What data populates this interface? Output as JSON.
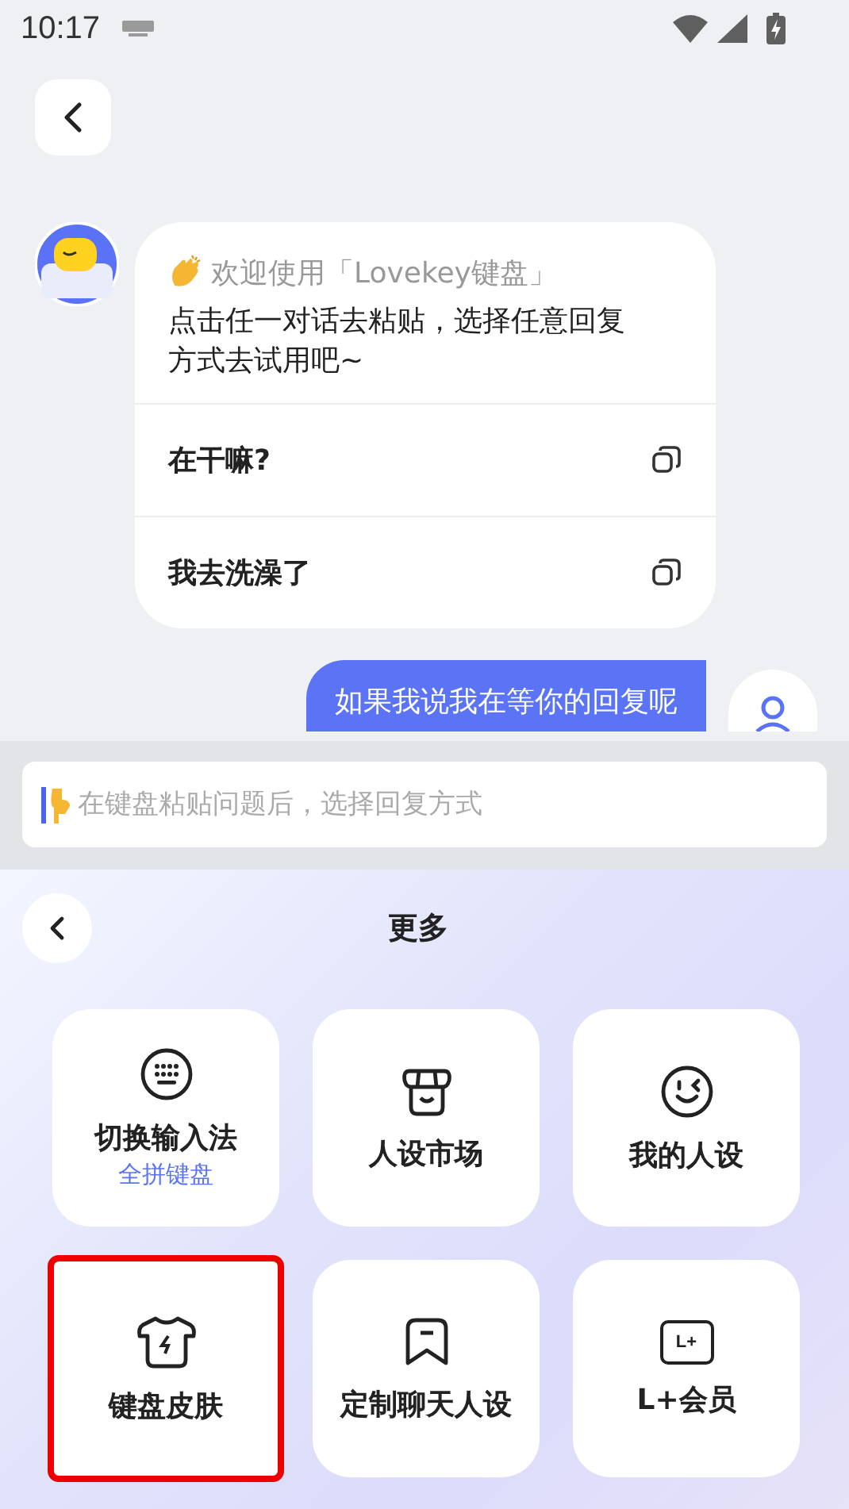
{
  "status_bar": {
    "time": "10:17"
  },
  "chat": {
    "welcome_title": "欢迎使用「Lovekey键盘」",
    "welcome_text": "点击任一对话去粘贴，选择任意回复方式去试用吧~",
    "replies": [
      "在干嘛?",
      "我去洗澡了"
    ],
    "user_message": "如果我说我在等你的回复呢"
  },
  "input": {
    "placeholder": "在键盘粘贴问题后，选择回复方式"
  },
  "panel": {
    "title": "更多",
    "tiles": [
      {
        "kind": "keyboard",
        "label": "切换输入法",
        "sublabel": "全拼键盘",
        "highlighted": false
      },
      {
        "kind": "store",
        "label": "人设市场",
        "highlighted": false
      },
      {
        "kind": "smile",
        "label": "我的人设",
        "highlighted": false
      },
      {
        "kind": "shirt",
        "label": "键盘皮肤",
        "highlighted": true
      },
      {
        "kind": "bookmark",
        "label": "定制聊天人设",
        "highlighted": false
      },
      {
        "kind": "ticket",
        "label": "L+会员",
        "icon_text": "L+",
        "highlighted": false
      }
    ]
  }
}
